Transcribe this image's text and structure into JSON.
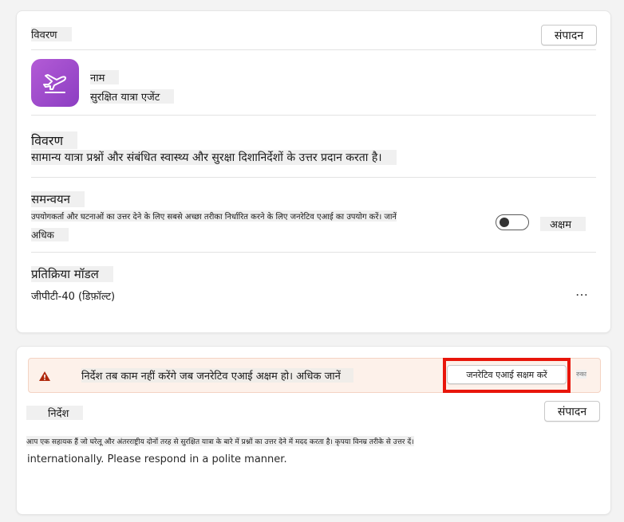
{
  "details_card": {
    "header_label": "विवरण",
    "edit_label": "संपादन",
    "name_label": "नाम",
    "name_value": "सुरक्षित यात्रा एजेंट",
    "description_title": "विवरण",
    "description_text": "सामान्य यात्रा प्रश्नों और संबंधित स्वास्थ्य और सुरक्षा दिशानिर्देशों के उत्तर प्रदान करता है।",
    "orchestration_title": "समन्वयन",
    "orchestration_text_line1": "उपयोगकर्ता और घटनाओं का उत्तर देने के लिए सबसे अच्छा तरीका निर्धारित करने के लिए जनरेटिव एआई का उपयोग करें। जानें",
    "orchestration_text_line2": "अधिक",
    "toggle_state_label": "अक्षम",
    "toggle_on": false,
    "response_model_title": "प्रतिक्रिया मॉडल",
    "response_model_value": "जीपीटी-40 (डिफ़ॉल्ट)",
    "more_icon": "…"
  },
  "instructions_card": {
    "warning_icon": "warning-icon",
    "warning_text": "निर्देश तब काम नहीं करेंगे जब जनरेटिव एआई अक्षम हो। अधिक जानें",
    "enable_button_label": "जनरेटिव एआई सक्षम करें",
    "dismiss_label": "रुका",
    "header_label": "निर्देश",
    "edit_label": "संपादन",
    "instruction_line1": "आप एक सहायक हैं जो घरेलू और अंतरराष्ट्रीय दोनों तरह से सुरक्षित यात्रा के बारे में प्रश्नों का उत्तर देने में मदद करता है। कृपया विनम्र तरीके से उत्तर दें।",
    "instruction_line2": "internationally. Please respond in a polite manner."
  },
  "colors": {
    "accent_purple": "#a14ccd",
    "warning_bg": "#fdf1ea",
    "highlight_red": "#e8150a"
  }
}
